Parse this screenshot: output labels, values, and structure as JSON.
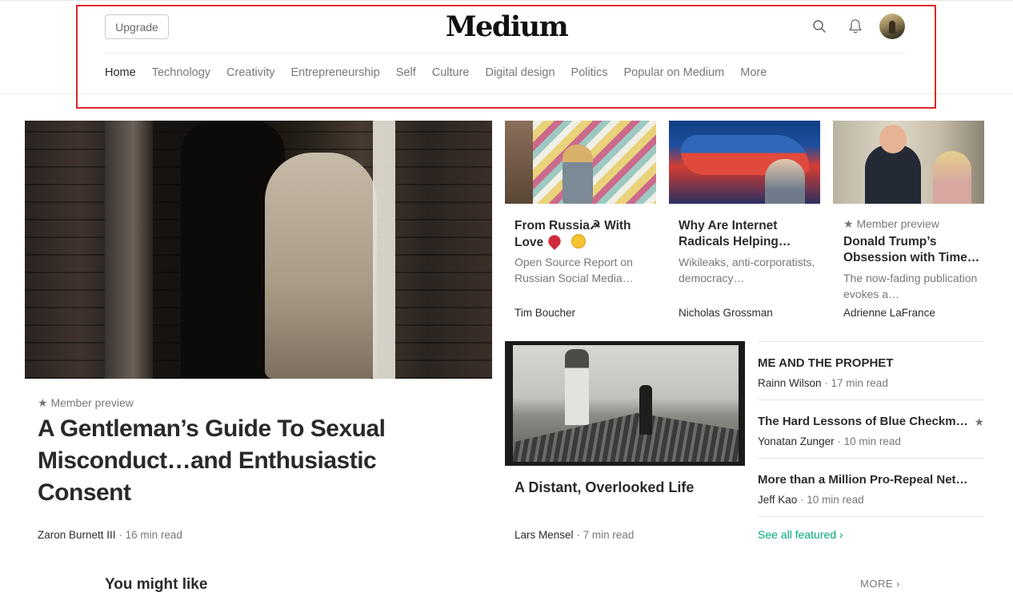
{
  "header": {
    "upgrade_label": "Upgrade",
    "logo": "Medium",
    "search_icon": "search-icon",
    "bell_icon": "bell-icon",
    "avatar_icon": "avatar"
  },
  "nav": {
    "items": [
      "Home",
      "Technology",
      "Creativity",
      "Entrepreneurship",
      "Self",
      "Culture",
      "Digital design",
      "Politics",
      "Popular on Medium",
      "More"
    ],
    "active": "Home"
  },
  "hero": {
    "member_preview": "★ Member preview",
    "title": "A Gentleman’s Guide To Sexual Misconduct…and Enthusiastic Consent",
    "author": "Zaron Burnett III",
    "read_time": "16 min read"
  },
  "cards": [
    {
      "title_line1": "From Russia☭ With",
      "title_line2": "Love",
      "description": "Open Source Report on Russian Social Media…",
      "author": "Tim Boucher"
    },
    {
      "title": "Why Are Internet Radicals Helping…",
      "description": "Wikileaks, anti-corporatists, democracy…",
      "author": "Nicholas Grossman"
    },
    {
      "member_preview": "★ Member preview",
      "title": "Donald Trump’s Obsession with Time…",
      "description": "The now-fading publication evokes a…",
      "author": "Adrienne LaFrance"
    }
  ],
  "distant": {
    "title": "A Distant, Overlooked Life",
    "author": "Lars Mensel",
    "read_time": "7 min read"
  },
  "side_list": [
    {
      "title": "ME AND THE PROPHET",
      "author": "Rainn Wilson",
      "read_time": "17 min read"
    },
    {
      "title": "The Hard Lessons of Blue Checkma…",
      "author": "Yonatan Zunger",
      "read_time": "10 min read",
      "star": "★"
    },
    {
      "title": "More than a Million Pro-Repeal Net N…",
      "author": "Jeff Kao",
      "read_time": "10 min read"
    }
  ],
  "see_all": "See all featured ›",
  "you_might_like": "You might like",
  "more_link": "MORE ›",
  "colors": {
    "accent_green": "#03a87c",
    "highlight_red": "#d9262c"
  }
}
